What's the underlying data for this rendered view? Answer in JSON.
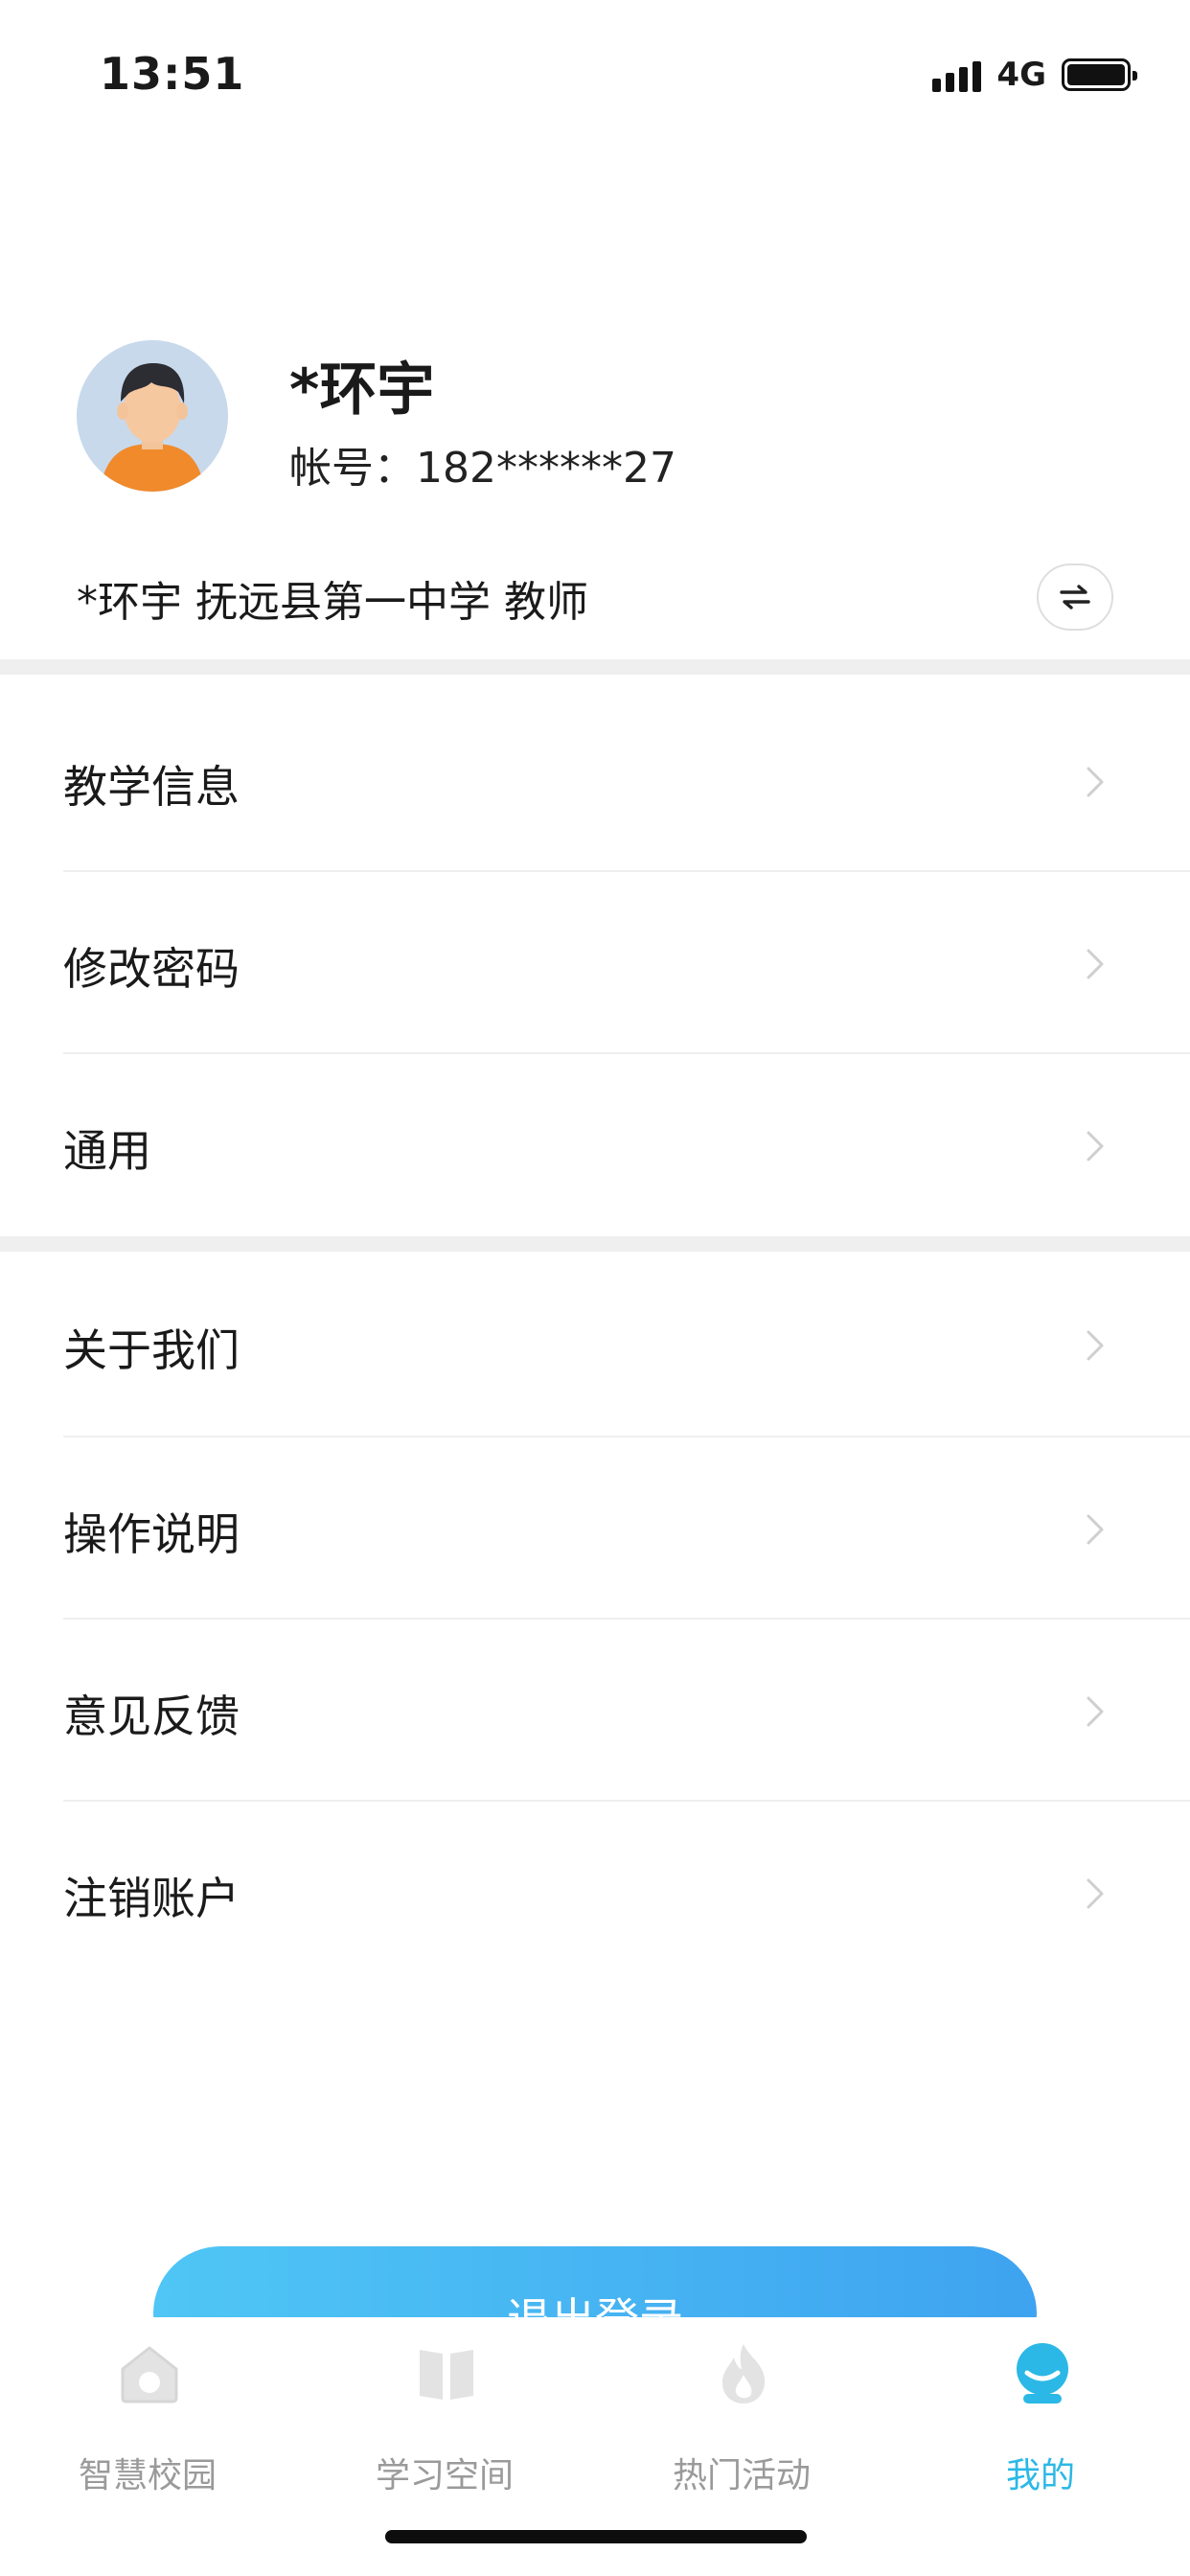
{
  "status_bar": {
    "time": "13:51",
    "network": "4G",
    "icons": [
      "signal-icon",
      "battery-icon"
    ]
  },
  "profile": {
    "name": "*环宇",
    "account_label": "帐号：",
    "account_value": "182******27",
    "school_info": "*环宇 抚远县第一中学 教师"
  },
  "menu": {
    "group1": [
      {
        "label": "教学信息"
      },
      {
        "label": "修改密码"
      },
      {
        "label": "通用"
      }
    ],
    "group2": [
      {
        "label": "关于我们"
      },
      {
        "label": "操作说明"
      },
      {
        "label": "意见反馈"
      },
      {
        "label": "注销账户"
      }
    ]
  },
  "logout_label": "退出登录",
  "tabbar": {
    "active_color": "#2bb8e6",
    "inactive_color": "#9a9a9a",
    "tabs": [
      {
        "label": "智慧校园",
        "icon": "school-home-icon"
      },
      {
        "label": "学习空间",
        "icon": "book-icon"
      },
      {
        "label": "热门活动",
        "icon": "flame-icon"
      },
      {
        "label": "我的",
        "icon": "user-profile-icon",
        "active": true
      }
    ]
  }
}
